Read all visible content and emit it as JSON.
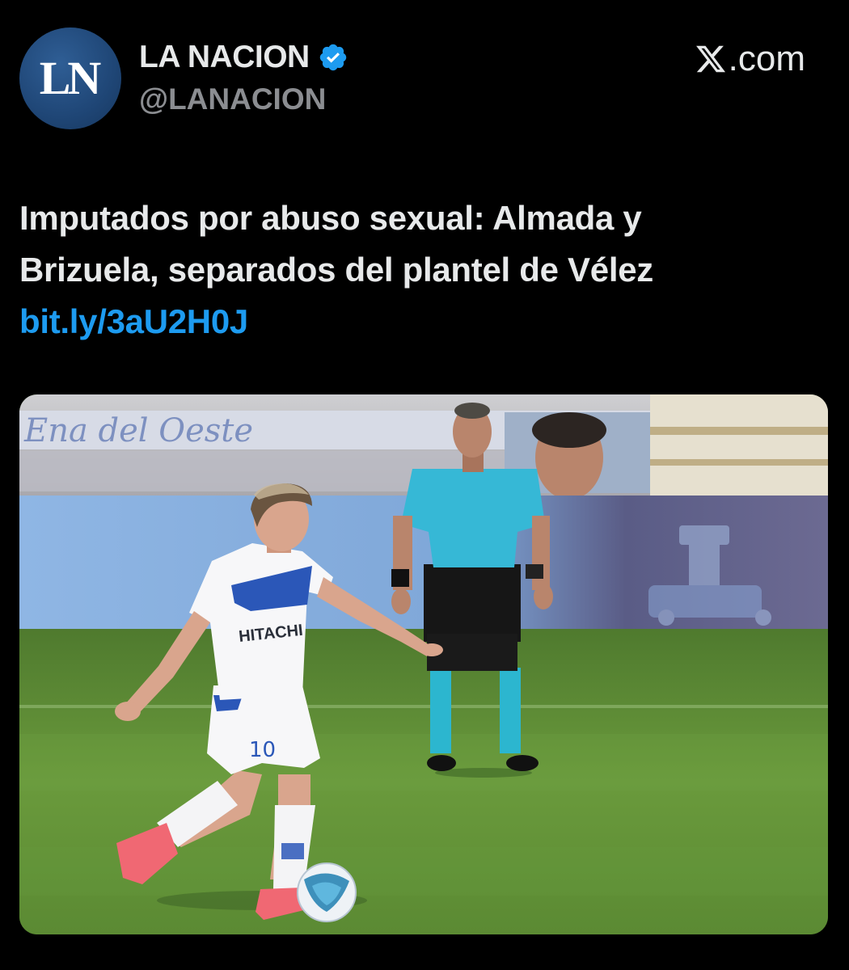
{
  "account": {
    "display_name": "LA NACION",
    "handle": "@LANACION",
    "avatar_text": "LN",
    "verified_icon": "verified-badge-icon",
    "verified_color": "#1d9bf0"
  },
  "brand": {
    "label": ".com",
    "icon": "x-logo-icon"
  },
  "tweet": {
    "line1": "Imputados por abuso sexual: Almada y",
    "line2": "Brizuela, separados del plantel de Vélez",
    "link": "bit.ly/3aU2H0J",
    "link_color": "#1d9bf0"
  },
  "media": {
    "shirt_sponsor": "HITACHI",
    "shirt_number": "10",
    "banner_text": "Ena del Oeste"
  },
  "colors": {
    "background": "#000000",
    "text": "#e7e9ea",
    "muted": "#8b8d91",
    "accent": "#1d9bf0"
  }
}
